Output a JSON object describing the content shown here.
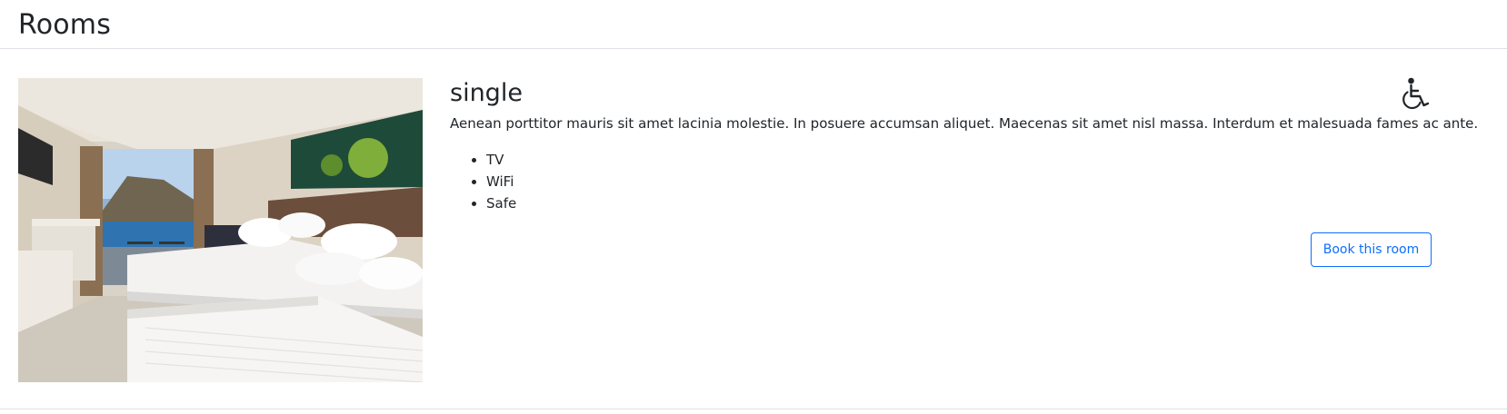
{
  "header": {
    "title": "Rooms"
  },
  "room": {
    "type": "single",
    "description": "Aenean porttitor mauris sit amet lacinia molestie. In posuere accumsan aliquet. Maecenas sit amet nisl massa. Interdum et malesuada fames ac ante.",
    "features": [
      "TV",
      "WiFi",
      "Safe"
    ],
    "accessible_icon": "wheelchair-icon",
    "book_label": "Book this room",
    "image": "room-photo"
  },
  "colors": {
    "primary": "#0d6efd",
    "text": "#212529",
    "border": "#dee2e6"
  }
}
